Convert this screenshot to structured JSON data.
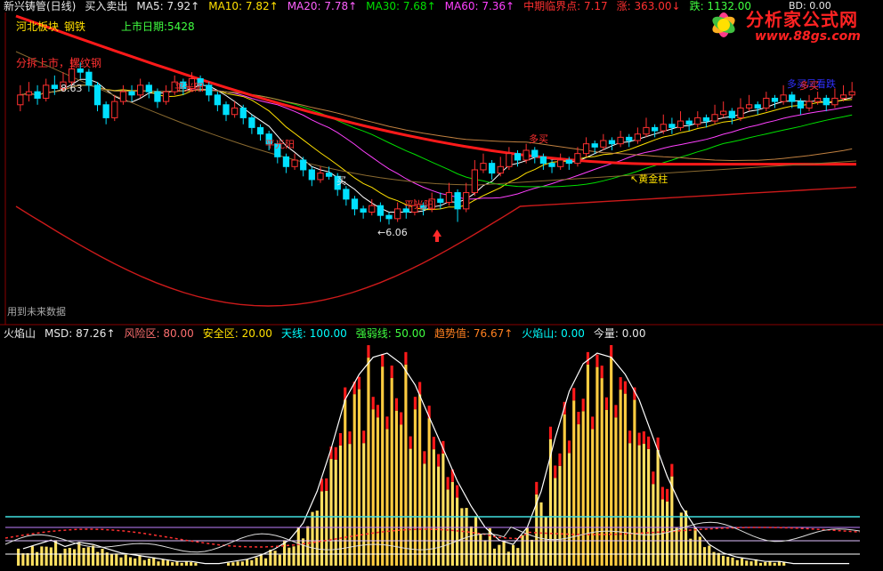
{
  "header": {
    "title": "新兴铸管(日线)",
    "indicator": "买入卖出",
    "ma5": "MA5: 7.92↑",
    "ma10": "MA10: 7.82↑",
    "ma20": "MA20: 7.78↑",
    "ma30": "MA30: 7.68↑",
    "ma60": "MA60: 7.36↑",
    "midline": "中期临界点: 7.17",
    "rise": "涨: 363.00↓",
    "fall": "跌: 1132.00",
    "right_value": "BD: 0.00"
  },
  "board": {
    "sector": "河北板块",
    "industry": "钢铁",
    "listing": "上市日期:5428"
  },
  "annotations": {
    "split": "分拆上市，螺纹钢",
    "price_high": "8.63",
    "price_low": "←6.06",
    "ping1": "平光阳",
    "ping2": "平光阳",
    "ping3": "平光阳",
    "buy": "买",
    "duomai1": "多买",
    "duomai2": "多买",
    "gold": "↖黄金柱",
    "wind": "多买凤看跌",
    "future": "用到未来数据"
  },
  "sub_header": {
    "name": "火焰山",
    "msd": "MSD: 87.26↑",
    "risk": "风险区: 80.00",
    "safe": "安全区: 20.00",
    "sky": "天线: 100.00",
    "strength": "强弱线: 50.00",
    "trend": "趋势值: 76.67↑",
    "volcano": "火焰山: 0.00",
    "volume": "今量: 0.00"
  },
  "logo": {
    "name": "分析家公式网",
    "url": "www.88gs.com"
  },
  "colors": {
    "background": "#000000",
    "up": "#ff3030",
    "down": "#00e0ff",
    "ma5": "#ffffff",
    "ma10": "#ffe000",
    "ma20": "#ff40ff",
    "ma30": "#00e000"
  },
  "chart_data": [
    {
      "type": "candlestick",
      "title": "新兴铸管(日线)",
      "annotations": [
        {
          "label": "8.63",
          "kind": "high"
        },
        {
          "label": "←6.06",
          "kind": "low"
        }
      ],
      "candles": [
        [
          7.9,
          8.05,
          8.2,
          7.8
        ],
        [
          8.05,
          8.1,
          8.25,
          7.95
        ],
        [
          8.1,
          8.0,
          8.2,
          7.9
        ],
        [
          8.0,
          8.2,
          8.3,
          7.95
        ],
        [
          8.2,
          8.15,
          8.35,
          8.05
        ],
        [
          8.15,
          8.25,
          8.4,
          8.1
        ],
        [
          8.25,
          8.45,
          8.63,
          8.2
        ],
        [
          8.45,
          8.4,
          8.55,
          8.3
        ],
        [
          8.4,
          8.2,
          8.45,
          8.1
        ],
        [
          8.2,
          7.9,
          8.25,
          7.8
        ],
        [
          7.9,
          7.7,
          7.95,
          7.6
        ],
        [
          7.7,
          7.95,
          8.05,
          7.65
        ],
        [
          7.95,
          8.1,
          8.2,
          7.9
        ],
        [
          8.1,
          8.05,
          8.2,
          7.95
        ],
        [
          8.05,
          8.2,
          8.3,
          8.0
        ],
        [
          8.2,
          8.1,
          8.25,
          8.0
        ],
        [
          8.1,
          7.95,
          8.15,
          7.85
        ],
        [
          7.95,
          8.1,
          8.2,
          7.9
        ],
        [
          8.1,
          8.25,
          8.35,
          8.05
        ],
        [
          8.25,
          8.15,
          8.3,
          8.05
        ],
        [
          8.15,
          8.3,
          8.4,
          8.1
        ],
        [
          8.3,
          8.2,
          8.35,
          8.1
        ],
        [
          8.2,
          8.05,
          8.25,
          7.95
        ],
        [
          8.05,
          7.9,
          8.1,
          7.8
        ],
        [
          7.9,
          7.75,
          7.95,
          7.65
        ],
        [
          7.75,
          7.85,
          7.95,
          7.7
        ],
        [
          7.85,
          7.7,
          7.9,
          7.6
        ],
        [
          7.7,
          7.55,
          7.75,
          7.45
        ],
        [
          7.55,
          7.45,
          7.6,
          7.35
        ],
        [
          7.45,
          7.3,
          7.5,
          7.2
        ],
        [
          7.3,
          7.1,
          7.35,
          7.0
        ],
        [
          7.1,
          6.95,
          7.15,
          6.85
        ],
        [
          6.95,
          7.05,
          7.15,
          6.9
        ],
        [
          7.05,
          6.9,
          7.1,
          6.8
        ],
        [
          6.9,
          6.75,
          6.95,
          6.65
        ],
        [
          6.75,
          6.85,
          6.95,
          6.7
        ],
        [
          6.85,
          6.8,
          6.95,
          6.75
        ],
        [
          6.8,
          6.6,
          6.85,
          6.5
        ],
        [
          6.6,
          6.45,
          6.65,
          6.35
        ],
        [
          6.45,
          6.3,
          6.5,
          6.2
        ],
        [
          6.3,
          6.25,
          6.35,
          6.15
        ],
        [
          6.25,
          6.35,
          6.45,
          6.2
        ],
        [
          6.35,
          6.2,
          6.4,
          6.1
        ],
        [
          6.2,
          6.15,
          6.25,
          6.06
        ],
        [
          6.15,
          6.3,
          6.4,
          6.1
        ],
        [
          6.3,
          6.25,
          6.35,
          6.15
        ],
        [
          6.25,
          6.35,
          6.45,
          6.2
        ],
        [
          6.35,
          6.3,
          6.4,
          6.2
        ],
        [
          6.3,
          6.45,
          6.55,
          6.25
        ],
        [
          6.45,
          6.4,
          6.55,
          6.3
        ],
        [
          6.4,
          6.55,
          6.7,
          6.35
        ],
        [
          6.55,
          6.3,
          6.6,
          6.1
        ],
        [
          6.3,
          6.55,
          6.7,
          6.25
        ],
        [
          6.55,
          6.9,
          7.05,
          6.5
        ],
        [
          6.9,
          7.0,
          7.15,
          6.85
        ],
        [
          7.0,
          6.85,
          7.05,
          6.75
        ],
        [
          6.85,
          6.95,
          7.1,
          6.8
        ],
        [
          6.95,
          7.15,
          7.25,
          6.9
        ],
        [
          7.15,
          7.05,
          7.2,
          6.95
        ],
        [
          7.05,
          7.2,
          7.3,
          7.0
        ],
        [
          7.2,
          7.1,
          7.25,
          7.0
        ],
        [
          7.1,
          7.0,
          7.15,
          6.9
        ],
        [
          7.0,
          6.95,
          7.05,
          6.85
        ],
        [
          6.95,
          7.05,
          7.15,
          6.9
        ],
        [
          7.05,
          7.0,
          7.1,
          6.9
        ],
        [
          7.0,
          7.15,
          7.25,
          6.95
        ],
        [
          7.15,
          7.3,
          7.4,
          7.1
        ],
        [
          7.3,
          7.25,
          7.35,
          7.15
        ],
        [
          7.25,
          7.35,
          7.45,
          7.2
        ],
        [
          7.35,
          7.3,
          7.4,
          7.2
        ],
        [
          7.3,
          7.4,
          7.5,
          7.25
        ],
        [
          7.4,
          7.35,
          7.45,
          7.25
        ],
        [
          7.35,
          7.45,
          7.55,
          7.3
        ],
        [
          7.45,
          7.55,
          7.7,
          7.4
        ],
        [
          7.55,
          7.5,
          7.6,
          7.4
        ],
        [
          7.5,
          7.6,
          7.75,
          7.45
        ],
        [
          7.6,
          7.55,
          7.7,
          7.45
        ],
        [
          7.55,
          7.65,
          7.8,
          7.5
        ],
        [
          7.65,
          7.6,
          7.7,
          7.5
        ],
        [
          7.6,
          7.7,
          7.8,
          7.55
        ],
        [
          7.7,
          7.65,
          7.75,
          7.55
        ],
        [
          7.65,
          7.75,
          7.9,
          7.6
        ],
        [
          7.75,
          7.8,
          7.95,
          7.7
        ],
        [
          7.8,
          7.7,
          7.85,
          7.6
        ],
        [
          7.7,
          7.85,
          8.0,
          7.65
        ],
        [
          7.85,
          7.9,
          8.05,
          7.8
        ],
        [
          7.9,
          7.85,
          7.95,
          7.75
        ],
        [
          7.85,
          8.0,
          8.1,
          7.8
        ],
        [
          8.0,
          7.95,
          8.05,
          7.85
        ],
        [
          7.95,
          8.05,
          8.2,
          7.9
        ],
        [
          8.05,
          7.95,
          8.1,
          7.85
        ],
        [
          7.95,
          7.85,
          8.0,
          7.75
        ],
        [
          7.85,
          7.95,
          8.05,
          7.8
        ],
        [
          7.95,
          8.0,
          8.1,
          7.9
        ],
        [
          8.0,
          7.9,
          8.05,
          7.8
        ],
        [
          7.9,
          8.0,
          8.15,
          7.85
        ],
        [
          8.0,
          8.05,
          8.2,
          7.95
        ],
        [
          8.05,
          8.1,
          8.25,
          8.0
        ]
      ]
    },
    {
      "type": "bar",
      "title": "火焰山",
      "series": [
        {
          "name": "MSD",
          "values": [
            8,
            10,
            12,
            9,
            11,
            10,
            8,
            6,
            5,
            4,
            3,
            2,
            2,
            1,
            1,
            2,
            3,
            5,
            8,
            12,
            20,
            35,
            55,
            78,
            90,
            98,
            100,
            95,
            85,
            70,
            55,
            40,
            28,
            18,
            12,
            10,
            18,
            35,
            60,
            82,
            95,
            100,
            98,
            90,
            78,
            60,
            42,
            28,
            18,
            10,
            6,
            4,
            3,
            2,
            2,
            1,
            1,
            1,
            1,
            1
          ]
        }
      ]
    }
  ]
}
